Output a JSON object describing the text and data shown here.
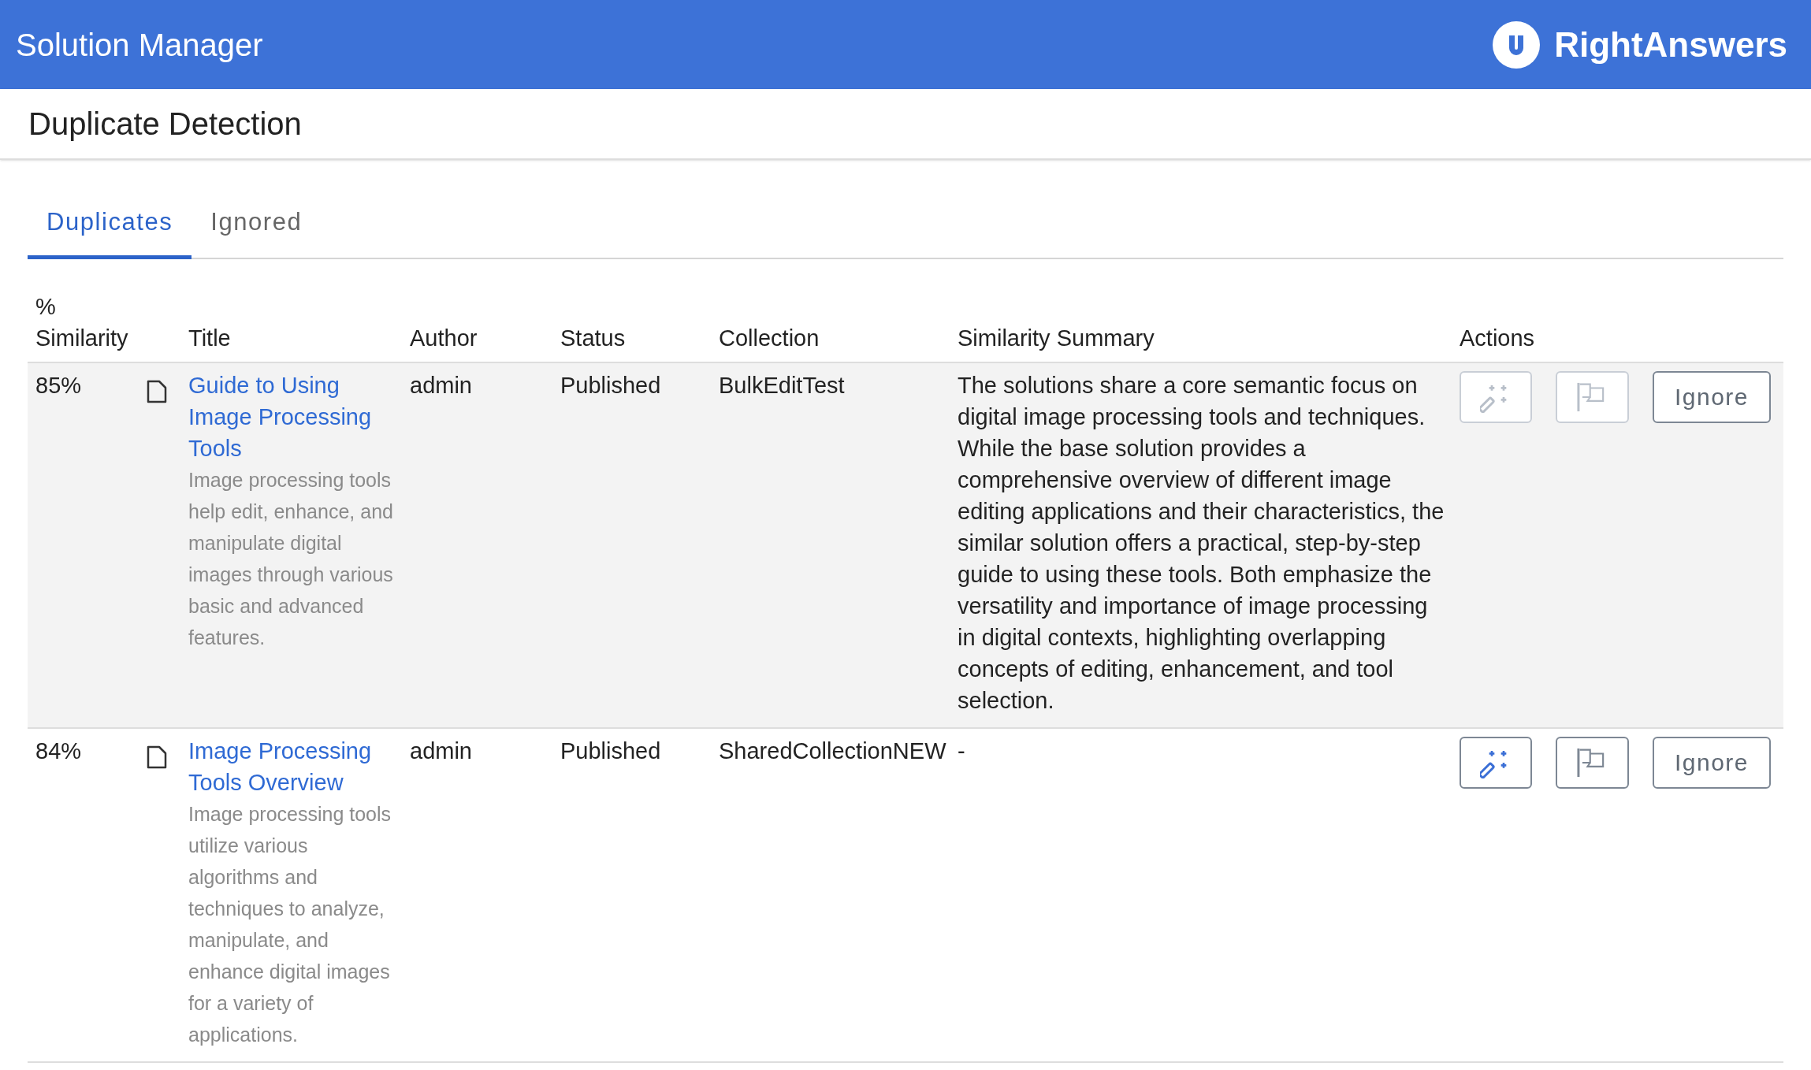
{
  "header": {
    "title": "Solution Manager",
    "logo_text": "RightAnswers"
  },
  "page_title": "Duplicate Detection",
  "tabs": [
    {
      "label": "Duplicates",
      "selected": true
    },
    {
      "label": "Ignored",
      "selected": false
    }
  ],
  "table": {
    "columns": [
      "% Similarity",
      "Title",
      "Author",
      "Status",
      "Collection",
      "Similarity Summary",
      "Actions"
    ],
    "rows": [
      {
        "highlighted": true,
        "similarity": "85%",
        "title": "Guide to Using Image Processing Tools",
        "description": "Image processing tools help edit, enhance, and manipulate digital images through various basic and advanced features.",
        "author": "admin",
        "status": "Published",
        "collection": "BulkEditTest",
        "summary": "The solutions share a core semantic focus on digital image processing tools and techniques. While the base solution provides a comprehensive overview of different image editing applications and their characteristics, the similar solution offers a practical, step-by-step guide to using these tools. Both emphasize the versatility and importance of image processing in digital contexts, highlighting overlapping concepts of editing, enhancement, and tool selection.",
        "actions": {
          "merge_disabled": true,
          "flag_disabled": true,
          "ignore_label": "Ignore"
        }
      },
      {
        "highlighted": false,
        "similarity": "84%",
        "title": "Image Processing Tools Overview",
        "description": "Image processing tools utilize various algorithms and techniques to analyze, manipulate, and enhance digital images for a variety of applications.",
        "author": "admin",
        "status": "Published",
        "collection": "SharedCollectionNEW",
        "summary": "-",
        "actions": {
          "merge_disabled": false,
          "flag_disabled": false,
          "ignore_label": "Ignore"
        }
      }
    ]
  }
}
